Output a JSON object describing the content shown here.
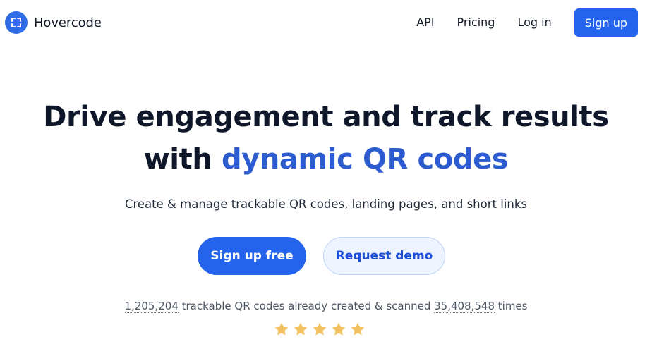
{
  "brand": {
    "name": "Hovercode",
    "logo_color": "#2f6ce5"
  },
  "nav": {
    "api": "API",
    "pricing": "Pricing",
    "login": "Log in",
    "signup": "Sign up"
  },
  "hero": {
    "title_line1": "Drive engagement and track results",
    "title_line2_prefix": "with ",
    "title_line2_accent": "dynamic QR codes",
    "accent_color": "#2d5bd0",
    "subtitle": "Create & manage trackable QR codes, landing pages, and short links"
  },
  "cta": {
    "primary": "Sign up free",
    "secondary": "Request demo"
  },
  "stats": {
    "codes_created": "1,205,204",
    "middle_text": " trackable QR codes already created & scanned ",
    "scans": "35,408,548",
    "suffix": " times"
  },
  "rating": {
    "stars": 5,
    "star_color": "#f2c261",
    "icon": "star-icon"
  }
}
